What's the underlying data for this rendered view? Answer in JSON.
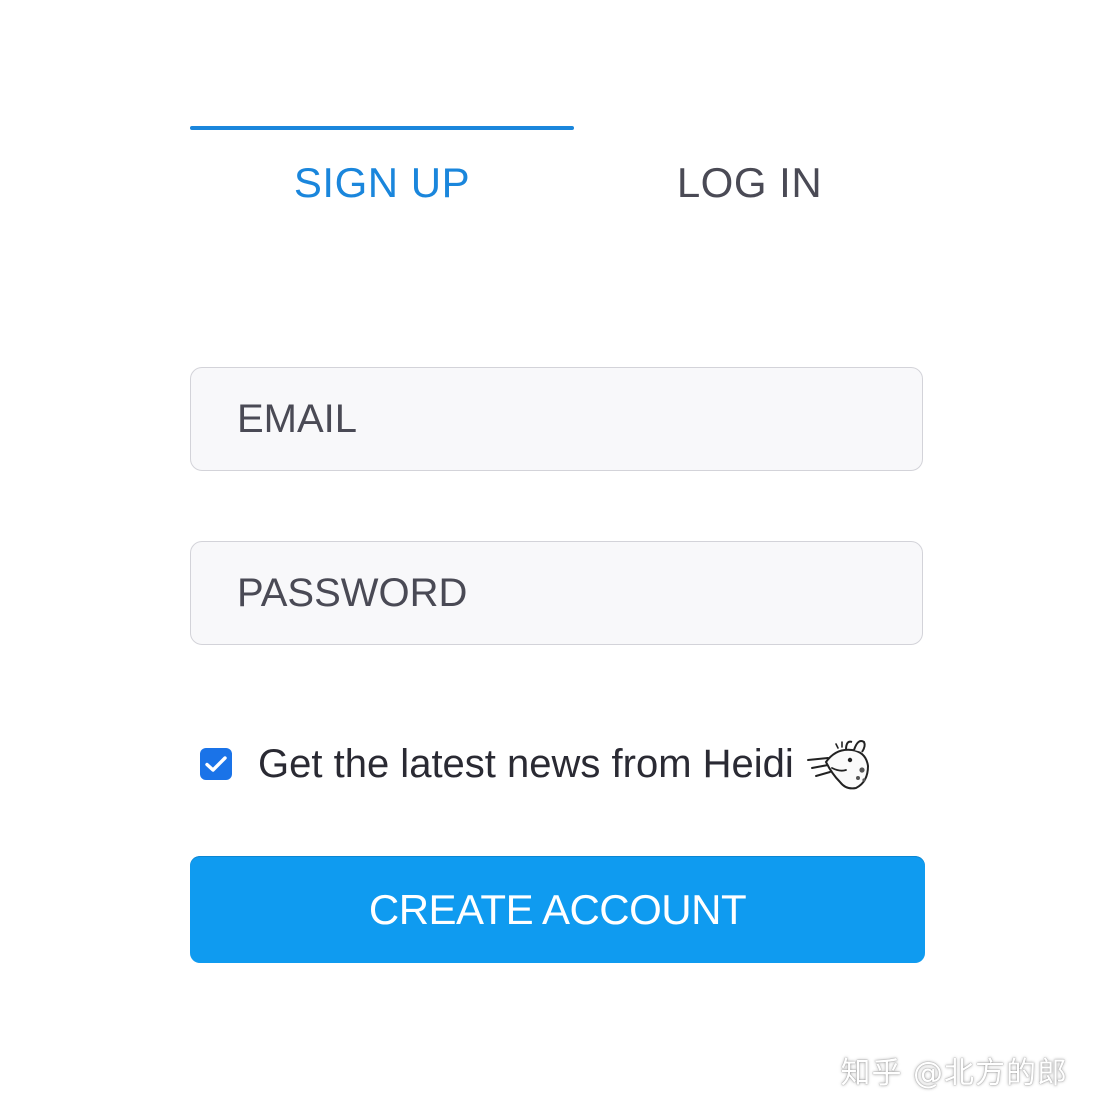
{
  "tabs": {
    "signup_label": "SIGN UP",
    "login_label": "LOG IN",
    "active": "signup"
  },
  "form": {
    "email_placeholder": "EMAIL",
    "email_value": "",
    "password_placeholder": "PASSWORD",
    "password_value": "",
    "newsletter_label": "Get the latest news from Heidi",
    "newsletter_checked": true,
    "mascot_icon": "heidi-mascot-icon",
    "submit_label": "CREATE ACCOUNT"
  },
  "watermark": {
    "text": "知乎 @北方的郎"
  },
  "colors": {
    "accent": "#1a86dc",
    "button": "#0f9bf0",
    "checkbox": "#1a73e8",
    "input_bg": "#f8f8fa",
    "input_border": "#d3d3d9"
  }
}
